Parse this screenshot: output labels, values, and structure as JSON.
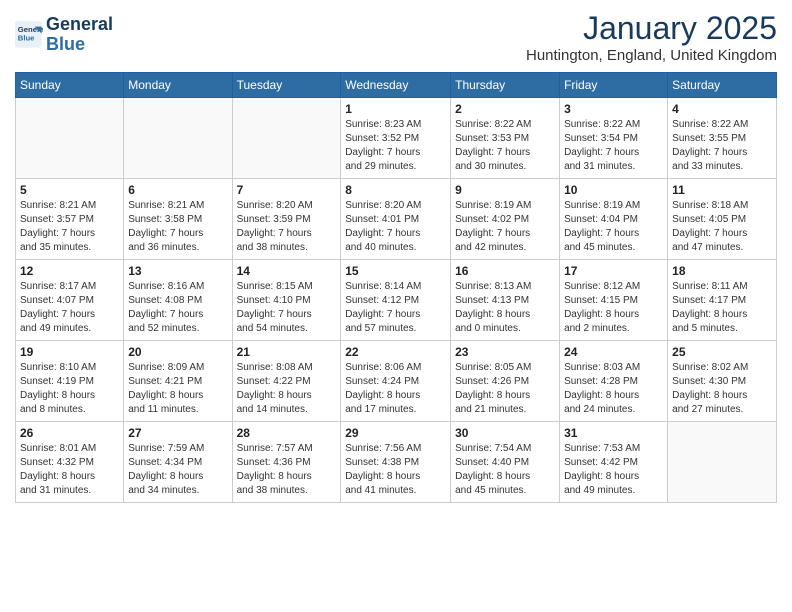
{
  "logo": {
    "line1": "General",
    "line2": "Blue"
  },
  "title": "January 2025",
  "location": "Huntington, England, United Kingdom",
  "weekdays": [
    "Sunday",
    "Monday",
    "Tuesday",
    "Wednesday",
    "Thursday",
    "Friday",
    "Saturday"
  ],
  "weeks": [
    [
      {
        "day": "",
        "info": ""
      },
      {
        "day": "",
        "info": ""
      },
      {
        "day": "",
        "info": ""
      },
      {
        "day": "1",
        "info": "Sunrise: 8:23 AM\nSunset: 3:52 PM\nDaylight: 7 hours\nand 29 minutes."
      },
      {
        "day": "2",
        "info": "Sunrise: 8:22 AM\nSunset: 3:53 PM\nDaylight: 7 hours\nand 30 minutes."
      },
      {
        "day": "3",
        "info": "Sunrise: 8:22 AM\nSunset: 3:54 PM\nDaylight: 7 hours\nand 31 minutes."
      },
      {
        "day": "4",
        "info": "Sunrise: 8:22 AM\nSunset: 3:55 PM\nDaylight: 7 hours\nand 33 minutes."
      }
    ],
    [
      {
        "day": "5",
        "info": "Sunrise: 8:21 AM\nSunset: 3:57 PM\nDaylight: 7 hours\nand 35 minutes."
      },
      {
        "day": "6",
        "info": "Sunrise: 8:21 AM\nSunset: 3:58 PM\nDaylight: 7 hours\nand 36 minutes."
      },
      {
        "day": "7",
        "info": "Sunrise: 8:20 AM\nSunset: 3:59 PM\nDaylight: 7 hours\nand 38 minutes."
      },
      {
        "day": "8",
        "info": "Sunrise: 8:20 AM\nSunset: 4:01 PM\nDaylight: 7 hours\nand 40 minutes."
      },
      {
        "day": "9",
        "info": "Sunrise: 8:19 AM\nSunset: 4:02 PM\nDaylight: 7 hours\nand 42 minutes."
      },
      {
        "day": "10",
        "info": "Sunrise: 8:19 AM\nSunset: 4:04 PM\nDaylight: 7 hours\nand 45 minutes."
      },
      {
        "day": "11",
        "info": "Sunrise: 8:18 AM\nSunset: 4:05 PM\nDaylight: 7 hours\nand 47 minutes."
      }
    ],
    [
      {
        "day": "12",
        "info": "Sunrise: 8:17 AM\nSunset: 4:07 PM\nDaylight: 7 hours\nand 49 minutes."
      },
      {
        "day": "13",
        "info": "Sunrise: 8:16 AM\nSunset: 4:08 PM\nDaylight: 7 hours\nand 52 minutes."
      },
      {
        "day": "14",
        "info": "Sunrise: 8:15 AM\nSunset: 4:10 PM\nDaylight: 7 hours\nand 54 minutes."
      },
      {
        "day": "15",
        "info": "Sunrise: 8:14 AM\nSunset: 4:12 PM\nDaylight: 7 hours\nand 57 minutes."
      },
      {
        "day": "16",
        "info": "Sunrise: 8:13 AM\nSunset: 4:13 PM\nDaylight: 8 hours\nand 0 minutes."
      },
      {
        "day": "17",
        "info": "Sunrise: 8:12 AM\nSunset: 4:15 PM\nDaylight: 8 hours\nand 2 minutes."
      },
      {
        "day": "18",
        "info": "Sunrise: 8:11 AM\nSunset: 4:17 PM\nDaylight: 8 hours\nand 5 minutes."
      }
    ],
    [
      {
        "day": "19",
        "info": "Sunrise: 8:10 AM\nSunset: 4:19 PM\nDaylight: 8 hours\nand 8 minutes."
      },
      {
        "day": "20",
        "info": "Sunrise: 8:09 AM\nSunset: 4:21 PM\nDaylight: 8 hours\nand 11 minutes."
      },
      {
        "day": "21",
        "info": "Sunrise: 8:08 AM\nSunset: 4:22 PM\nDaylight: 8 hours\nand 14 minutes."
      },
      {
        "day": "22",
        "info": "Sunrise: 8:06 AM\nSunset: 4:24 PM\nDaylight: 8 hours\nand 17 minutes."
      },
      {
        "day": "23",
        "info": "Sunrise: 8:05 AM\nSunset: 4:26 PM\nDaylight: 8 hours\nand 21 minutes."
      },
      {
        "day": "24",
        "info": "Sunrise: 8:03 AM\nSunset: 4:28 PM\nDaylight: 8 hours\nand 24 minutes."
      },
      {
        "day": "25",
        "info": "Sunrise: 8:02 AM\nSunset: 4:30 PM\nDaylight: 8 hours\nand 27 minutes."
      }
    ],
    [
      {
        "day": "26",
        "info": "Sunrise: 8:01 AM\nSunset: 4:32 PM\nDaylight: 8 hours\nand 31 minutes."
      },
      {
        "day": "27",
        "info": "Sunrise: 7:59 AM\nSunset: 4:34 PM\nDaylight: 8 hours\nand 34 minutes."
      },
      {
        "day": "28",
        "info": "Sunrise: 7:57 AM\nSunset: 4:36 PM\nDaylight: 8 hours\nand 38 minutes."
      },
      {
        "day": "29",
        "info": "Sunrise: 7:56 AM\nSunset: 4:38 PM\nDaylight: 8 hours\nand 41 minutes."
      },
      {
        "day": "30",
        "info": "Sunrise: 7:54 AM\nSunset: 4:40 PM\nDaylight: 8 hours\nand 45 minutes."
      },
      {
        "day": "31",
        "info": "Sunrise: 7:53 AM\nSunset: 4:42 PM\nDaylight: 8 hours\nand 49 minutes."
      },
      {
        "day": "",
        "info": ""
      }
    ]
  ]
}
